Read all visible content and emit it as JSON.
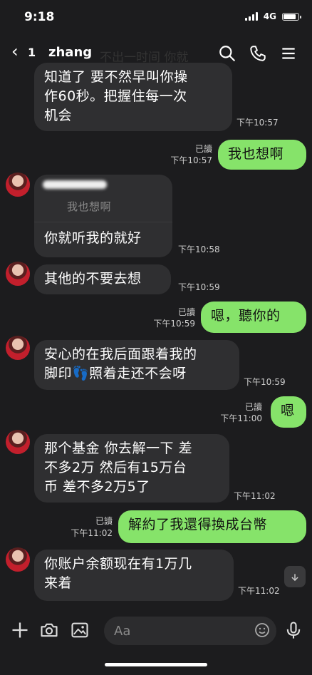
{
  "status": {
    "time": "9:18",
    "network": "4G"
  },
  "header": {
    "back_glyph": "‹",
    "unread": "1",
    "contact": "zhang",
    "bg_text": "不出一时间 你就"
  },
  "messages": {
    "m1": {
      "text": "知道了 要不然早叫你操\n作60秒。把握住每一次\n机会",
      "time": "下午10:57"
    },
    "m2": {
      "text": "我也想啊",
      "read": "已讀",
      "time": "下午10:57"
    },
    "m3": {
      "quote": "我也想啊",
      "text": "你就听我的就好",
      "time": "下午10:58"
    },
    "m4": {
      "text": "其他的不要去想",
      "time": "下午10:59"
    },
    "m5": {
      "text": "嗯，聽你的",
      "read": "已讀",
      "time": "下午10:59"
    },
    "m6": {
      "text": "安心的在我后面跟着我的\n脚印👣照着走还不会呀",
      "time": "下午10:59"
    },
    "m7": {
      "text": "嗯",
      "read": "已讀",
      "time": "下午11:00"
    },
    "m8": {
      "text": "那个基金 你去解一下 差\n不多2万 然后有15万台\n币 差不多2万5了",
      "time": "下午11:02"
    },
    "m9": {
      "text": "解約了我還得換成台幣",
      "read": "已讀",
      "time": "下午11:02"
    },
    "m10": {
      "text": "你账户余额现在有1万几\n来着",
      "time": "下午11:02"
    }
  },
  "input": {
    "placeholder": "Aa"
  },
  "colors": {
    "outgoing_bubble": "#86e36a",
    "incoming_bubble": "#2f2f31",
    "background": "#1c1c1e"
  },
  "icons": [
    "search-icon",
    "phone-icon",
    "menu-icon",
    "plus-icon",
    "camera-icon",
    "image-icon",
    "emoji-icon",
    "mic-icon",
    "chevron-down-icon"
  ]
}
